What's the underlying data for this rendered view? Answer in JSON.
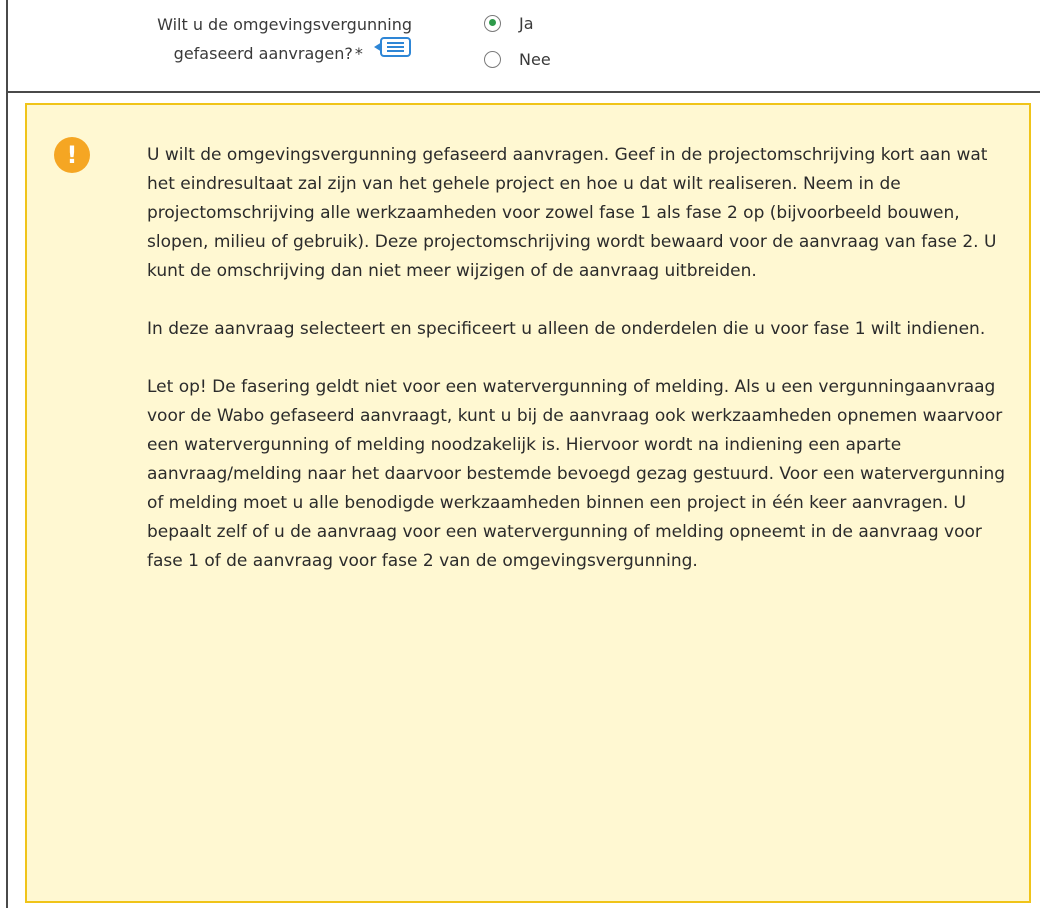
{
  "question": {
    "line1": "Wilt u de omgevingsvergunning",
    "line2": "gefaseerd aanvragen?",
    "required_mark": "*",
    "help_icon": "comment-help-icon",
    "options": [
      {
        "label": "Ja",
        "checked": true
      },
      {
        "label": "Nee",
        "checked": false
      }
    ]
  },
  "warning": {
    "icon": "exclamation-icon",
    "paragraphs": [
      "U wilt de omgevingsvergunning gefaseerd aanvragen. Geef in de projectomschrijving kort aan wat het eindresultaat zal zijn van het gehele project en hoe u dat wilt realiseren. Neem in de projectomschrijving alle werkzaamheden voor zowel fase 1 als fase 2 op (bijvoorbeeld bouwen, slopen, milieu of gebruik). Deze projectomschrijving wordt bewaard voor de aanvraag van fase 2. U kunt de omschrijving dan niet meer wijzigen of de aanvraag uitbreiden.",
      "In deze aanvraag selecteert en specificeert u alleen de onderdelen die u voor fase 1 wilt indienen.",
      "Let op! De fasering geldt niet voor een watervergunning of melding. Als u een vergunningaanvraag voor de Wabo gefaseerd aanvraagt, kunt u bij de aanvraag ook werkzaamheden opnemen waarvoor een watervergunning of melding noodzakelijk is. Hiervoor wordt na indiening een aparte aanvraag/melding naar het daarvoor bestemde bevoegd gezag gestuurd. Voor een watervergunning of melding moet u alle benodigde werkzaamheden binnen een project in één keer aanvragen. U bepaalt zelf of u de aanvraag voor een watervergunning of melding opneemt in de aanvraag voor fase 1 of de aanvraag voor fase 2 van de omgevingsvergunning."
    ]
  },
  "colors": {
    "warning_bg": "#fff8d2",
    "warning_border": "#f0c419",
    "warning_icon": "#f5a623",
    "radio_dot": "#2e9a4a",
    "help_icon_blue": "#2e86d6"
  }
}
